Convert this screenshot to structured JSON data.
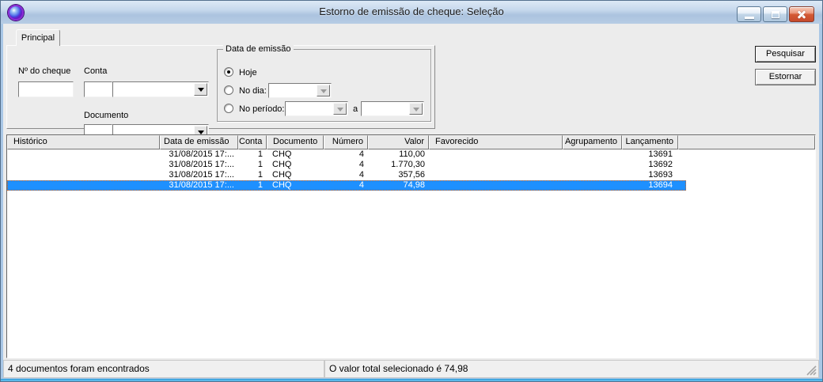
{
  "window": {
    "title": "Estorno de emissão de cheque: Seleção"
  },
  "titlebar": {
    "icons": [
      "app-icon",
      "minimize-icon",
      "maximize-icon",
      "close-icon"
    ]
  },
  "tabs": [
    {
      "label": "Principal"
    }
  ],
  "form": {
    "cheque": {
      "label": "Nº do cheque",
      "value": ""
    },
    "conta": {
      "label": "Conta",
      "code_value": "",
      "name_value": ""
    },
    "documento": {
      "label": "Documento",
      "code_value": "",
      "name_value": ""
    },
    "date_group": {
      "title": "Data de emissão",
      "options": [
        {
          "label": "Hoje",
          "selected": true
        },
        {
          "label": "No dia:",
          "selected": false
        },
        {
          "label": "No período:",
          "selected": false
        }
      ],
      "no_dia_value": "",
      "periodo_from_value": "",
      "periodo_separator": "a",
      "periodo_to_value": ""
    }
  },
  "actions": {
    "pesquisar": "Pesquisar",
    "estornar": "Estornar"
  },
  "grid": {
    "columns": [
      {
        "label": "Histórico"
      },
      {
        "label": "Data de emissão"
      },
      {
        "label": "Conta"
      },
      {
        "label": "Documento"
      },
      {
        "label": "Número"
      },
      {
        "label": "Valor"
      },
      {
        "label": "Favorecido"
      },
      {
        "label": "Agrupamento"
      },
      {
        "label": "Lançamento"
      },
      {
        "label": ""
      }
    ],
    "rows": [
      {
        "cells": [
          "",
          "31/08/2015 17:...",
          "1",
          "CHQ",
          "4",
          "110,00",
          "",
          "",
          "13691"
        ],
        "selected": false
      },
      {
        "cells": [
          "",
          "31/08/2015 17:...",
          "1",
          "CHQ",
          "4",
          "1.770,30",
          "",
          "",
          "13692"
        ],
        "selected": false
      },
      {
        "cells": [
          "",
          "31/08/2015 17:...",
          "1",
          "CHQ",
          "4",
          "357,56",
          "",
          "",
          "13693"
        ],
        "selected": false
      },
      {
        "cells": [
          "",
          "31/08/2015 17:...",
          "1",
          "CHQ",
          "4",
          "74,98",
          "",
          "",
          "13694"
        ],
        "selected": true
      }
    ],
    "selected_index": 3
  },
  "statusbar": {
    "left": "4 documentos foram encontrados",
    "right": "O valor total selecionado é 74,98"
  },
  "colors": {
    "selection": "#1E90FF",
    "selection_focus_dots": "#D0651F",
    "titlebar_top": "#DCE9F6",
    "titlebar_bottom": "#B6CCE4",
    "window_border": "#A9C7E6",
    "client_background": "#ECECEC",
    "close_button": "#C6492B"
  }
}
